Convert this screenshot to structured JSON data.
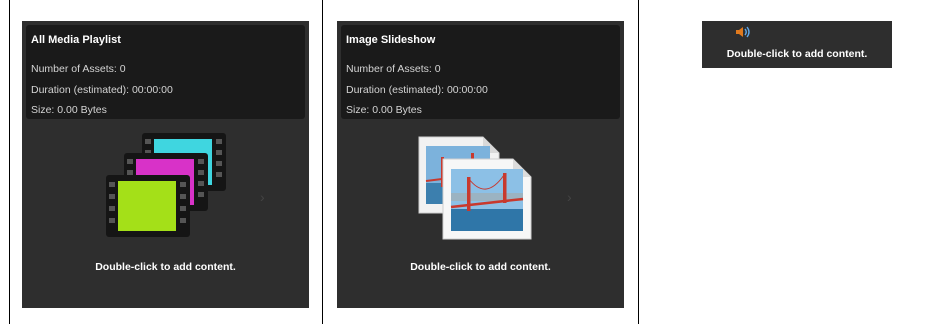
{
  "tiles": [
    {
      "title": "All Media Playlist",
      "assets": "Number of Assets: 0",
      "duration": "Duration (estimated): 00:00:00",
      "size": "Size: 0.00 Bytes",
      "icon": "film-stack-icon",
      "caption": "Double-click to add content."
    },
    {
      "title": "Image Slideshow",
      "assets": "Number of Assets: 0",
      "duration": "Duration (estimated): 00:00:00",
      "size": "Size: 0.00 Bytes",
      "icon": "image-stack-icon",
      "caption": "Double-click to add content."
    }
  ],
  "audio_tile": {
    "icon": "speaker-icon",
    "caption": "Double-click to add content."
  },
  "colors": {
    "tile_bg": "#2e2e2e",
    "info_bg": "#1a1a1a",
    "text": "#ffffff",
    "text_muted": "#d4d4d4"
  }
}
